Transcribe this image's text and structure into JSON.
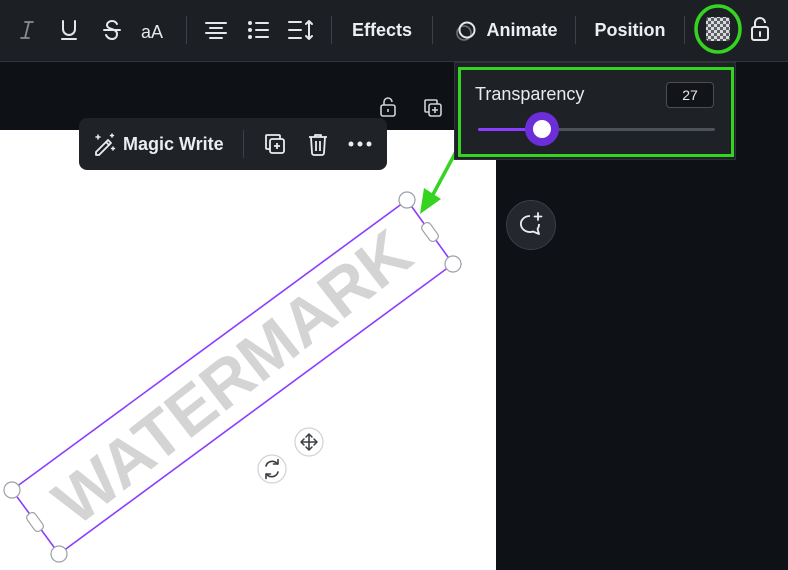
{
  "toolbar": {
    "effects_label": "Effects",
    "animate_label": "Animate",
    "position_label": "Position",
    "icons": [
      "italic-icon",
      "underline-icon",
      "strikethrough-icon",
      "case-icon",
      "align-center-icon",
      "list-icon",
      "spacing-icon",
      "transparency-icon",
      "lock-icon"
    ]
  },
  "transparency": {
    "label": "Transparency",
    "value": "27",
    "fraction": 0.27
  },
  "context_menu": {
    "magic_write_label": "Magic Write",
    "icons": [
      "magic-write-icon",
      "duplicate-icon",
      "trash-icon",
      "more-icon"
    ]
  },
  "canvas": {
    "watermark_text": "WATERMARK"
  },
  "colors": {
    "toolbar_bg": "#1c1f24",
    "accent_purple": "#8b3dff",
    "highlight_green": "#34d420",
    "watermark_gray": "#d4d4d4"
  }
}
